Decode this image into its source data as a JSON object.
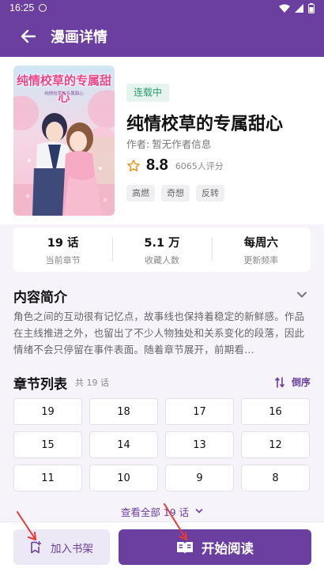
{
  "status_bar": {
    "time": "16:25"
  },
  "app_bar": {
    "title": "漫画详情"
  },
  "comic": {
    "status_badge": "连载中",
    "title": "纯情校草的专属甜心",
    "cover_title": "纯情校草的专属甜心",
    "cover_subtitle": "纯情校草的专属甜心",
    "author_label": "作者:",
    "author": "暂无作者信息",
    "rating": "8.8",
    "rating_count": "6065人评分",
    "tags": [
      "高燃",
      "奇想",
      "反转"
    ]
  },
  "stats": [
    {
      "value": "19 话",
      "label": "当前章节"
    },
    {
      "value": "5.1 万",
      "label": "收藏人数"
    },
    {
      "value": "每周六",
      "label": "更新频率"
    }
  ],
  "intro": {
    "heading": "内容简介",
    "text": "角色之间的互动很有记忆点，故事线也保持着稳定的新鲜感。作品在主线推进之外，也留出了不少人物独处和关系变化的段落，因此情绪不会只停留在事件表面。随着章节展开，前期看…"
  },
  "chapters": {
    "heading": "章节列表",
    "total": "共 19 话",
    "order_label": "倒序",
    "items": [
      "19",
      "18",
      "17",
      "16",
      "15",
      "14",
      "13",
      "12",
      "11",
      "10",
      "9",
      "8"
    ],
    "view_all": "查看全部 19 话"
  },
  "actions": {
    "shelf_label": "加入书架",
    "read_label": "开始阅读"
  },
  "colors": {
    "primary": "#6b3fa0",
    "badge_bg": "#e5f4ee",
    "badge_text": "#2c9a6d",
    "annotation": "#e53935"
  },
  "icons": [
    "back-arrow-icon",
    "star-icon",
    "chevron-down-icon",
    "sort-icon",
    "bookmark-icon",
    "book-open-icon"
  ]
}
